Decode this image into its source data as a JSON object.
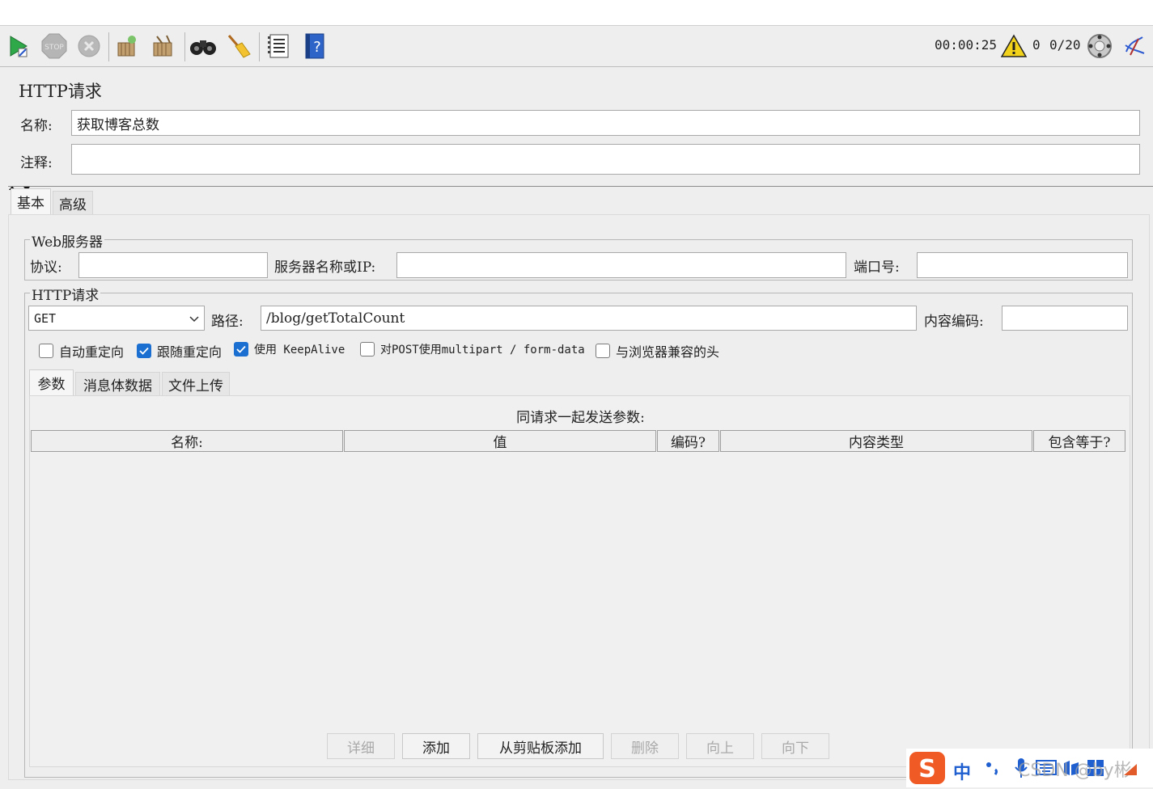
{
  "toolbar": {
    "timer": "00:00:25",
    "warning_count": "0",
    "threads": "0/20"
  },
  "sampler": {
    "title": "HTTP请求",
    "name_label": "名称:",
    "name_value": "获取博客总数",
    "comment_label": "注释:",
    "comment_value": ""
  },
  "tabs": [
    "基本",
    "高级"
  ],
  "web_server": {
    "title": "Web服务器",
    "protocol_label": "协议:",
    "protocol_value": "",
    "server_label": "服务器名称或IP:",
    "server_value": "",
    "port_label": "端口号:",
    "port_value": ""
  },
  "http_request": {
    "title": "HTTP请求",
    "method": "GET",
    "path_label": "路径:",
    "path_value": "/blog/getTotalCount",
    "encoding_label": "内容编码:",
    "encoding_value": ""
  },
  "checkboxes": [
    {
      "label": "自动重定向",
      "checked": false
    },
    {
      "label": "跟随重定向",
      "checked": true
    },
    {
      "label": "使用 KeepAlive",
      "checked": true
    },
    {
      "label": "对POST使用multipart / form-data",
      "checked": false
    },
    {
      "label": "与浏览器兼容的头",
      "checked": false
    }
  ],
  "param_tabs": [
    "参数",
    "消息体数据",
    "文件上传"
  ],
  "params": {
    "caption": "同请求一起发送参数:",
    "columns": [
      "名称:",
      "值",
      "编码?",
      "内容类型",
      "包含等于?"
    ]
  },
  "buttons": {
    "detail": "详细",
    "add": "添加",
    "add_clipboard": "从剪贴板添加",
    "delete": "删除",
    "up": "向上",
    "down": "向下"
  },
  "ime": {
    "lang": "中",
    "watermark": "CSDN @by彬"
  }
}
